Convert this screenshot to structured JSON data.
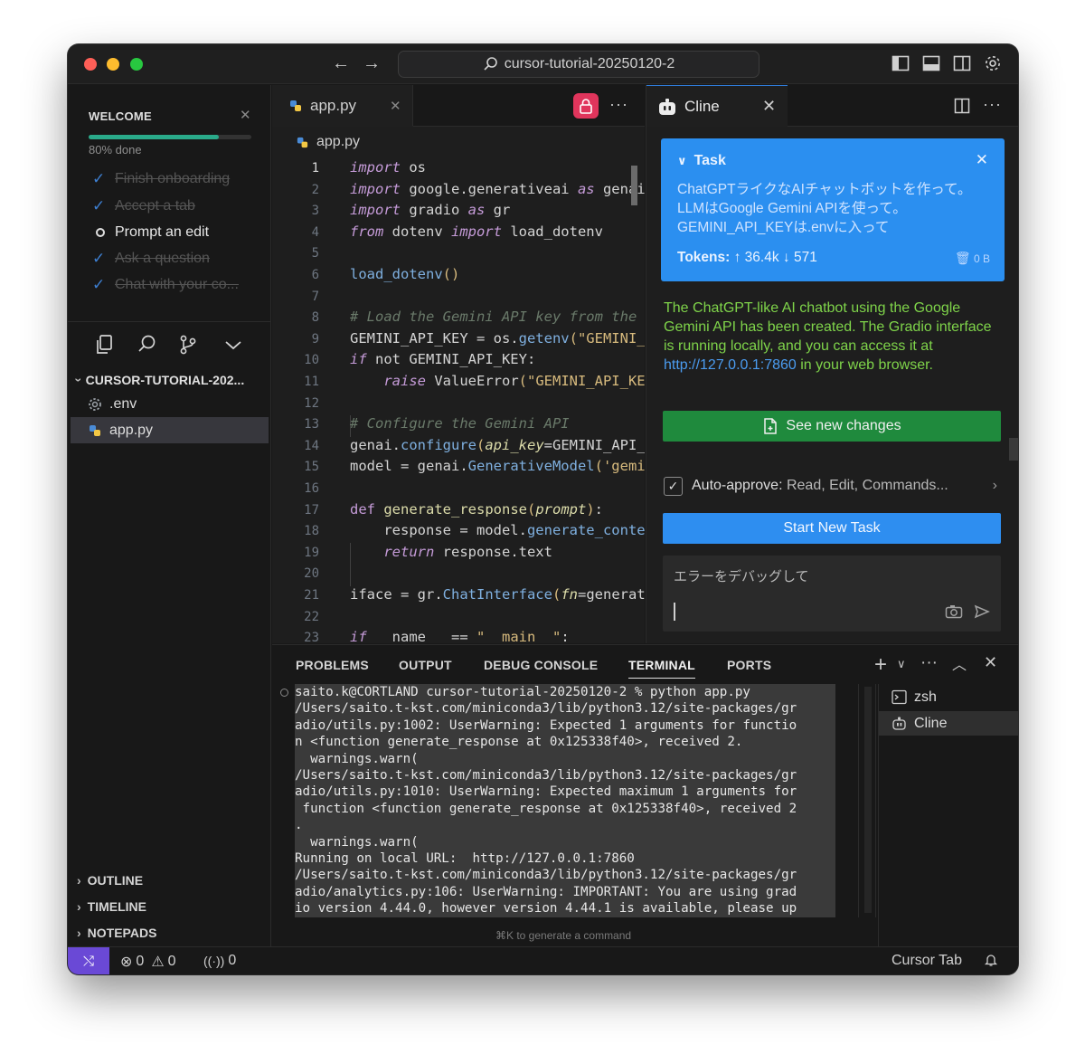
{
  "window": {
    "search_text": "cursor-tutorial-20250120-2"
  },
  "sidebar": {
    "welcome_title": "WELCOME",
    "progress": 0.8,
    "progress_label": "80% done",
    "steps": [
      {
        "label": "Finish onboarding",
        "done": true
      },
      {
        "label": "Accept a tab",
        "done": true
      },
      {
        "label": "Prompt an edit",
        "done": false
      },
      {
        "label": "Ask a question",
        "done": true
      },
      {
        "label": "Chat with your co...",
        "done": true
      }
    ],
    "explorer_root": "CURSOR-TUTORIAL-202...",
    "files": [
      ".env",
      "app.py"
    ],
    "sections": [
      "OUTLINE",
      "TIMELINE",
      "NOTEPADS"
    ]
  },
  "editor": {
    "tab_label": "app.py",
    "breadcrumb": "app.py",
    "line_numbers": [
      "1",
      "2",
      "3",
      "4",
      "5",
      "6",
      "7",
      "8",
      "9",
      "10",
      "11",
      "12",
      "13",
      "14",
      "15",
      "16",
      "17",
      "18",
      "19",
      "20",
      "21",
      "22",
      "23"
    ]
  },
  "cline": {
    "tab_label": "Cline",
    "task_header": "Task",
    "task_text": "ChatGPTライクなAIチャットボットを作って。LLMはGoogle Gemini APIを使って。GEMINI_API_KEYは.envに入って",
    "tokens_label": "Tokens:",
    "tokens_up": "36.4k",
    "tokens_down": "571",
    "size_label": "0 B",
    "response_text": "The ChatGPT-like AI chatbot using the Google Gemini API has been created. The Gradio interface is running locally, and you can access it at",
    "response_link": "http://127.0.0.1:7860",
    "response_tail": "in your web browser.",
    "see_changes_label": "See new changes",
    "auto_approve_label": "Auto-approve:",
    "auto_approve_value": "Read, Edit, Commands...",
    "auto_approve_checked": true,
    "new_task_label": "Start New Task",
    "input_placeholder": "エラーをデバッグして",
    "accent_blue": "#2b8ff0",
    "accent_green": "#1f8a3d"
  },
  "panel": {
    "tabs": [
      "PROBLEMS",
      "OUTPUT",
      "DEBUG CONSOLE",
      "TERMINAL",
      "PORTS"
    ],
    "active_tab": "TERMINAL",
    "terminal_lines": [
      "saito.k@CORTLAND cursor-tutorial-20250120-2 % python app.py",
      "/Users/saito.t-kst.com/miniconda3/lib/python3.12/site-packages/gr",
      "adio/utils.py:1002: UserWarning: Expected 1 arguments for functio",
      "n <function generate_response at 0x125338f40>, received 2.",
      "  warnings.warn(",
      "/Users/saito.t-kst.com/miniconda3/lib/python3.12/site-packages/gr",
      "adio/utils.py:1010: UserWarning: Expected maximum 1 arguments for",
      " function <function generate_response at 0x125338f40>, received 2",
      ".",
      "  warnings.warn(",
      "Running on local URL:  http://127.0.0.1:7860",
      "/Users/saito.t-kst.com/miniconda3/lib/python3.12/site-packages/gr",
      "adio/analytics.py:106: UserWarning: IMPORTANT: You are using grad",
      "io version 4.44.0, however version 4.44.1 is available, please up"
    ],
    "terminals": [
      "zsh",
      "Cline"
    ],
    "hint": "⌘K to generate a command"
  },
  "status": {
    "errors": "0",
    "warnings": "0",
    "ports": "0",
    "right_label": "Cursor Tab"
  }
}
